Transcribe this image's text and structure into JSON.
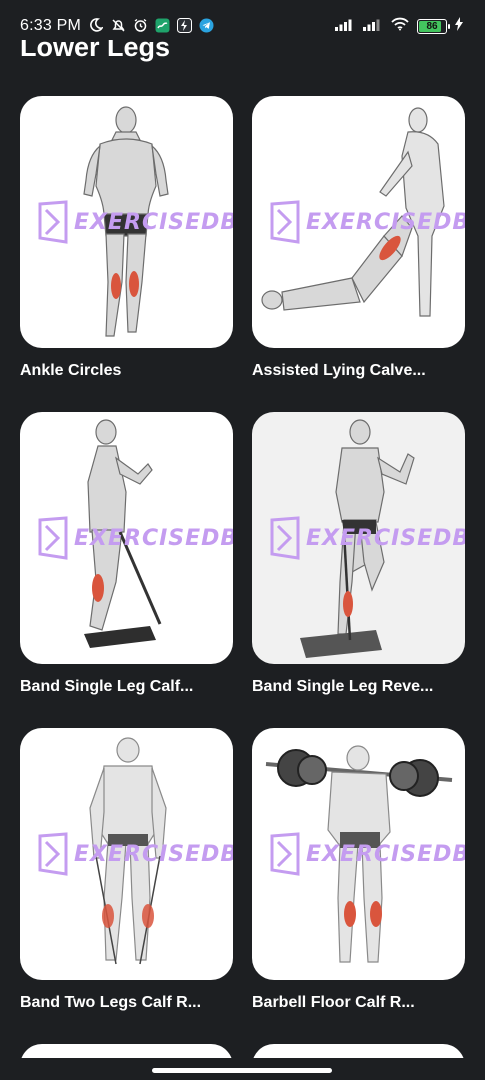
{
  "status_bar": {
    "time": "6:33 PM",
    "battery": "86",
    "left_icons": [
      "moon-icon",
      "bell-off-icon",
      "alarm-icon",
      "app-green-icon",
      "app-bolt-icon",
      "telegram-icon"
    ],
    "right_icons": [
      "signal-1-icon",
      "signal-2-icon",
      "wifi-icon",
      "battery-icon",
      "charging-icon"
    ]
  },
  "page": {
    "title": "Lower Legs"
  },
  "watermark": "EXERCISEDB",
  "colors": {
    "background": "#1d1f22",
    "card": "#ffffff",
    "watermark": "#c49cf0",
    "muscle_highlight": "#d9553d",
    "battery_fill": "#43c45e"
  },
  "exercises": [
    {
      "label": "Ankle Circles"
    },
    {
      "label": "Assisted Lying Calve..."
    },
    {
      "label": "Band Single Leg Calf..."
    },
    {
      "label": "Band Single Leg Reve..."
    },
    {
      "label": "Band Two Legs Calf R..."
    },
    {
      "label": "Barbell Floor Calf R..."
    }
  ]
}
